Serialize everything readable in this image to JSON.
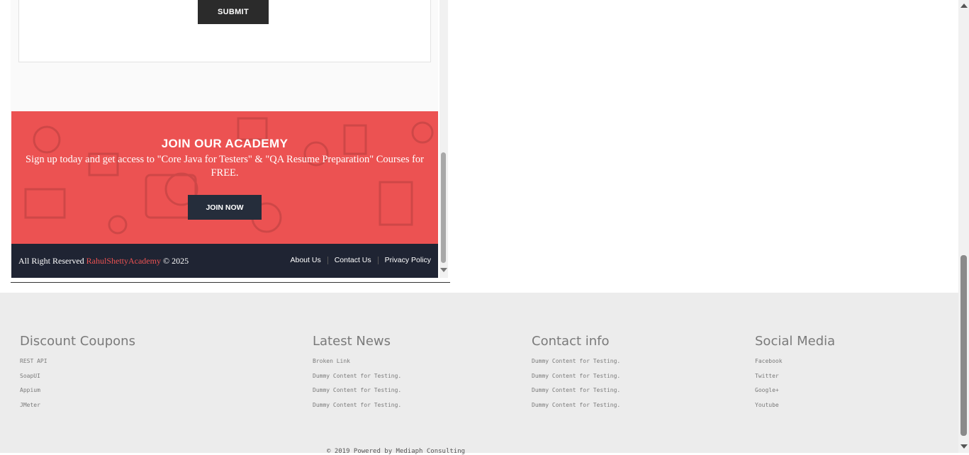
{
  "form": {
    "submit_label": "SUBMIT"
  },
  "join": {
    "title": "JOIN OUR ACADEMY",
    "text": "Sign up today and get access to \"Core Java for Testers\" & \"QA Resume Preparation\" Courses for FREE.",
    "button_label": "JOIN NOW",
    "bg_color": "#ec5252"
  },
  "iframe_footer": {
    "copyright_prefix": "All Right Reserved",
    "brand": "RahulShettyAcademy",
    "copyright_suffix": "© 2025",
    "links": [
      "About Us",
      "Contact Us",
      "Privacy Policy"
    ]
  },
  "footer": {
    "columns": [
      {
        "title": "Discount Coupons",
        "items": [
          "REST API",
          "SoapUI",
          "Appium",
          "JMeter"
        ]
      },
      {
        "title": "Latest News",
        "items": [
          "Broken Link",
          "Dummy Content for Testing.",
          "Dummy Content for Testing.",
          "Dummy Content for Testing."
        ]
      },
      {
        "title": "Contact info",
        "items": [
          "Dummy Content for Testing.",
          "Dummy Content for Testing.",
          "Dummy Content for Testing.",
          "Dummy Content for Testing."
        ]
      },
      {
        "title": "Social Media",
        "items": [
          "Facebook",
          "Twitter",
          "Google+",
          "Youtube"
        ]
      }
    ],
    "powered_by": "© 2019 Powered by Mediaph Consulting"
  },
  "colors": {
    "dark_footer": "#1f2433",
    "accent": "#ec5252",
    "site_footer_bg": "#ececec"
  }
}
